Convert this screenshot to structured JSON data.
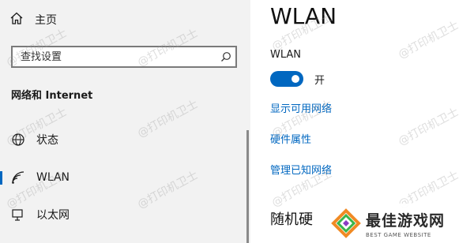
{
  "sidebar": {
    "home_label": "主页",
    "search_placeholder": "查找设置",
    "section_title": "网络和 Internet",
    "items": [
      {
        "label": "状态",
        "icon": "globe-icon"
      },
      {
        "label": "WLAN",
        "icon": "wifi-icon",
        "active": true
      },
      {
        "label": "以太网",
        "icon": "ethernet-icon"
      }
    ]
  },
  "main": {
    "title": "WLAN",
    "wlan_label": "WLAN",
    "toggle_state": "开",
    "links": [
      "显示可用网络",
      "硬件属性",
      "管理已知网络"
    ],
    "random_section": "随机硬"
  },
  "watermark": "@打印机卫士",
  "logo": {
    "main": "最佳游戏网",
    "sub": "BEST GAME WEBSITE"
  },
  "colors": {
    "accent": "#0067c0",
    "sidebar_bg": "#f2f2f2"
  }
}
